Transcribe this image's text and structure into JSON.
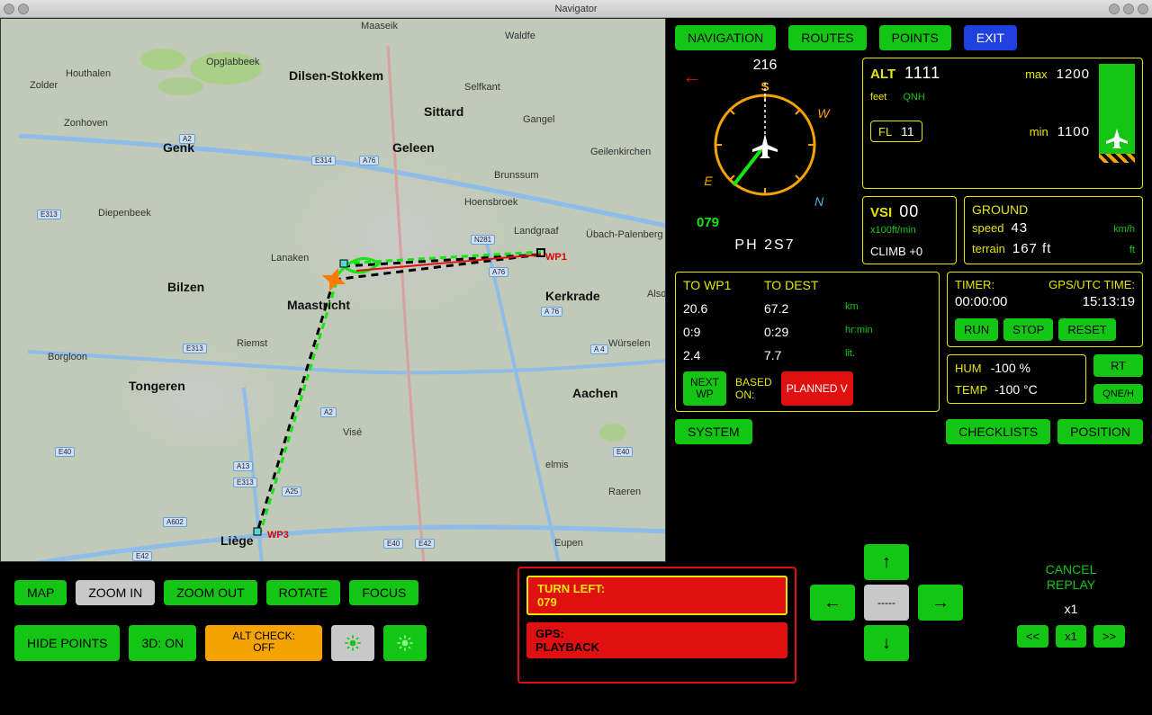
{
  "window": {
    "title": "Navigator"
  },
  "nav_buttons": {
    "navigation": "NAVIGATION",
    "routes": "ROUTES",
    "points": "POINTS",
    "exit": "EXIT"
  },
  "compass": {
    "heading": "216",
    "course": "079",
    "arrow": "←",
    "n": "N",
    "e": "E",
    "s": "S",
    "w": "W"
  },
  "callsign": "PH 2S7",
  "alt": {
    "label": "ALT",
    "value": "1111",
    "max_lbl": "max",
    "max": "1200",
    "min_lbl": "min",
    "min": "1100",
    "feet": "feet",
    "qnh": "QNH",
    "fl_lbl": "FL",
    "fl": "11"
  },
  "vsi": {
    "label": "VSI",
    "value": "00",
    "unit": "x100ft/min",
    "climb": "CLIMB +0"
  },
  "ground": {
    "label": "GROUND",
    "speed_lbl": "speed",
    "speed": "43",
    "speed_u": "km/h",
    "terrain_lbl": "terrain",
    "terrain": "167 ft",
    "terrain_u": "ft"
  },
  "wp": {
    "hdr_wp": "TO WP1",
    "hdr_dest": "TO DEST",
    "dist_wp": "20.6",
    "dist_dest": "67.2",
    "dist_u": "km",
    "time_wp": "0:9",
    "time_dest": "0:29",
    "time_u": "hr:min",
    "fuel_wp": "2.4",
    "fuel_dest": "7.7",
    "fuel_u": "lit.",
    "next_wp_l1": "NEXT",
    "next_wp_l2": "WP",
    "based_l1": "BASED",
    "based_l2": "ON:",
    "planned": "PLANNED V"
  },
  "timer": {
    "lbl": "TIMER:",
    "gps_lbl": "GPS/UTC TIME:",
    "t": "00:00:00",
    "gps": "15:13:19",
    "run": "RUN",
    "stop": "STOP",
    "reset": "RESET"
  },
  "hum": {
    "hum_lbl": "HUM",
    "hum": "-100 %",
    "temp_lbl": "TEMP",
    "temp": "-100 °C"
  },
  "side_buttons": {
    "rt": "RT",
    "qne": "QNE/H",
    "system": "SYSTEM",
    "checklists": "CHECKLISTS",
    "position": "POSITION"
  },
  "bottom_buttons": {
    "map": "MAP",
    "zoom_in": "ZOOM IN",
    "zoom_out": "ZOOM OUT",
    "rotate": "ROTATE",
    "focus": "FOCUS",
    "hide_points": "HIDE POINTS",
    "three_d": "3D: ON",
    "alt_check_l1": "ALT CHECK:",
    "alt_check_l2": "OFF"
  },
  "warnings": {
    "turn_l1": "TURN LEFT:",
    "turn_l2": "079",
    "gps_l1": "GPS:",
    "gps_l2": "PLAYBACK"
  },
  "dpad": {
    "up": "↑",
    "down": "↓",
    "left": "←",
    "right": "→",
    "center": "-----"
  },
  "replay": {
    "cancel_l1": "CANCEL",
    "cancel_l2": "REPLAY",
    "x1": "x1",
    "rew": "<<",
    "play": "x1",
    "fwd": ">>"
  },
  "map_labels": {
    "maaseik": "Maaseik",
    "waldfe": "Waldfe",
    "houthalen": "Houthalen",
    "zolder": "Zolder",
    "opglabbeek": "Opglabbeek",
    "dilsen": "Dilsen-Stokkem",
    "selfkant": "Selfkant",
    "zonhoven": "Zonhoven",
    "genk": "Genk",
    "sittard": "Sittard",
    "gangel": "Gangel",
    "geleen": "Geleen",
    "geilenkirchen": "Geilenkirchen",
    "brunssum": "Brunssum",
    "diepenbeek": "Diepenbeek",
    "hoensbroek": "Hoensbroek",
    "landgraaf": "Landgraaf",
    "ubach": "Übach-Palenberg",
    "bilzen": "Bilzen",
    "lanaken": "Lanaken",
    "kerkrade": "Kerkrade",
    "alsdo": "Alsdo",
    "maastricht": "Maastricht",
    "borgloon": "Borgloon",
    "riemst": "Riemst",
    "wurselen": "Würselen",
    "tongeren": "Tongeren",
    "aachen": "Aachen",
    "vise": "Visé",
    "elmis": "elmis",
    "raeren": "Raeren",
    "liege": "Liège",
    "eupen": "Eupen",
    "wp1": "WP1",
    "wp3": "WP3"
  },
  "shields": {
    "a2a": "A2",
    "e314": "E314",
    "a76": "A76",
    "e313a": "E313",
    "e313b": "E313",
    "n281": "N281",
    "a76b": "A76",
    "e40a": "E40",
    "a4": "A 4",
    "a76c": "A 76",
    "a2b": "A2",
    "a13": "A13",
    "e313c": "E313",
    "a25": "A25",
    "a602": "A602",
    "e42": "E42",
    "e40b": "E40",
    "e40c": "E40",
    "e42b": "E42"
  }
}
